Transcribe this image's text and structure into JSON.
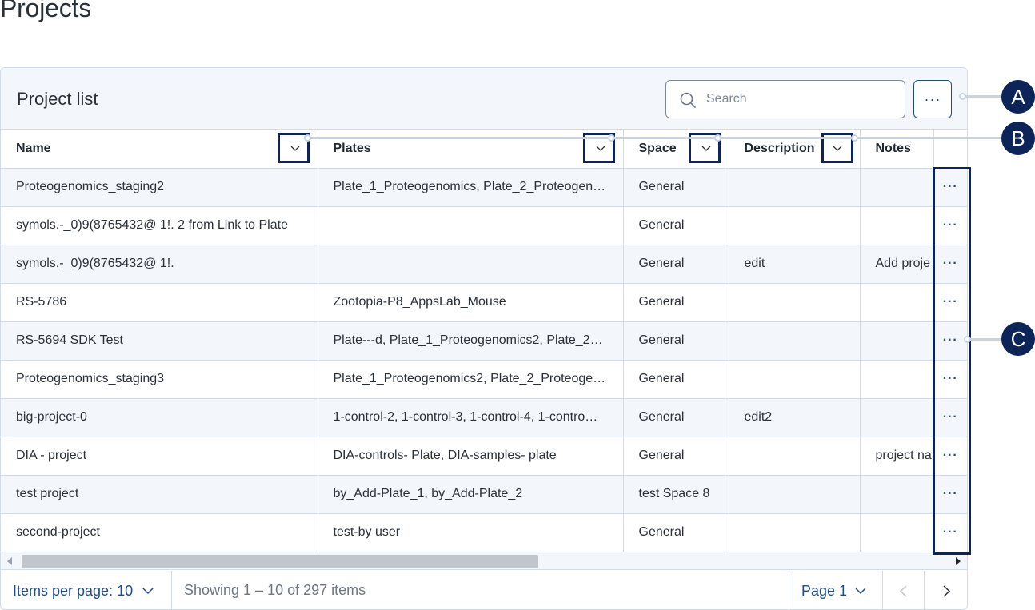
{
  "page": {
    "title": "Projects"
  },
  "card": {
    "title": "Project list",
    "search": {
      "placeholder": "Search",
      "value": ""
    },
    "more_label": "···"
  },
  "table": {
    "columns": [
      "Name",
      "Plates",
      "Space",
      "Description",
      "Notes"
    ],
    "row_action_label": "···",
    "rows": [
      {
        "name": "Proteogenomics_staging2",
        "plates": "Plate_1_Proteogenomics, Plate_2_Proteogen…",
        "space": "General",
        "description": "",
        "notes": ""
      },
      {
        "name": "symols.-_0)9(8765432@ 1!. 2 from Link to Plate",
        "plates": "",
        "space": "General",
        "description": "",
        "notes": ""
      },
      {
        "name": "symols.-_0)9(8765432@ 1!.",
        "plates": "",
        "space": "General",
        "description": "edit",
        "notes": "Add proje"
      },
      {
        "name": "RS-5786",
        "plates": "Zootopia-P8_AppsLab_Mouse",
        "space": "General",
        "description": "",
        "notes": ""
      },
      {
        "name": "RS-5694 SDK Test",
        "plates": "Plate---d, Plate_1_Proteogenomics2, Plate_2…",
        "space": "General",
        "description": "",
        "notes": ""
      },
      {
        "name": "Proteogenomics_staging3",
        "plates": "Plate_1_Proteogenomics2, Plate_2_Proteoge…",
        "space": "General",
        "description": "",
        "notes": ""
      },
      {
        "name": "big-project-0",
        "plates": "1-control-2, 1-control-3, 1-control-4, 1-contro…",
        "space": "General",
        "description": "edit2",
        "notes": ""
      },
      {
        "name": "DIA - project",
        "plates": "DIA-controls- Plate, DIA-samples- plate",
        "space": "General",
        "description": "",
        "notes": "project na"
      },
      {
        "name": "test project",
        "plates": "by_Add-Plate_1, by_Add-Plate_2",
        "space": "test Space 8",
        "description": "",
        "notes": ""
      },
      {
        "name": "second-project",
        "plates": "test-by user",
        "space": "General",
        "description": "",
        "notes": ""
      }
    ]
  },
  "footer": {
    "items_per_page": "Items per page: 10",
    "showing": "Showing 1 – 10 of 297 items",
    "page": "Page 1"
  },
  "callouts": {
    "a": "A",
    "b": "B",
    "c": "C"
  },
  "colors": {
    "accent": "#1d4c91",
    "callout": "#0d2459",
    "stripe": "#f3f6fa",
    "border": "#d3dbe7"
  }
}
